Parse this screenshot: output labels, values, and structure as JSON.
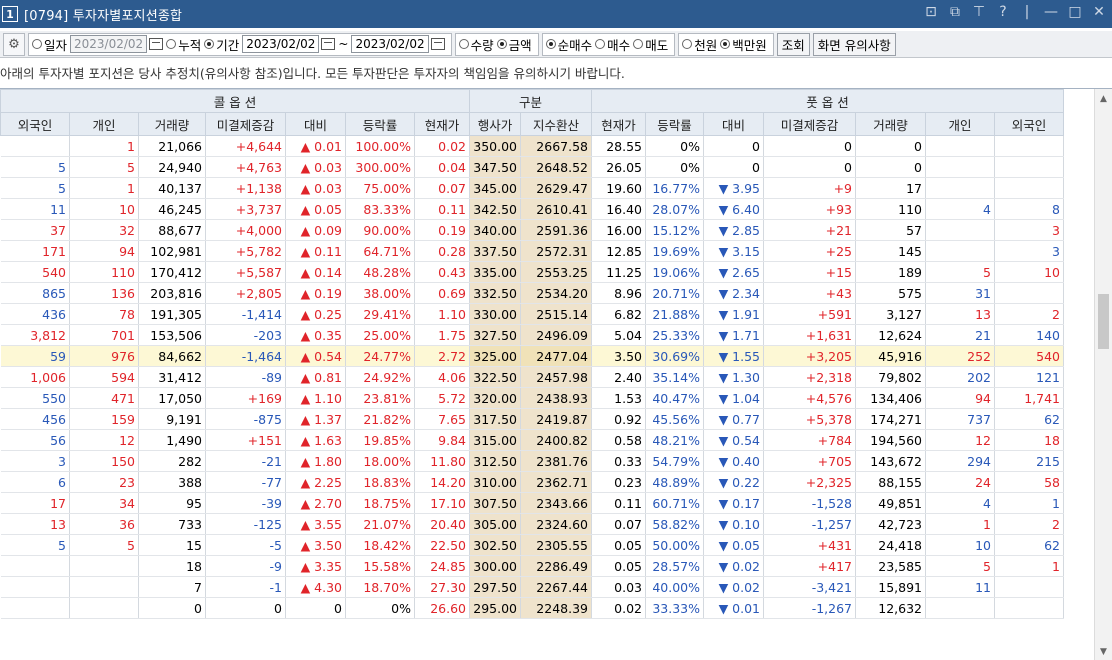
{
  "window": {
    "num": "1",
    "title": "[0794] 투자자별포지션종합",
    "controls": [
      "⊡",
      "⧉",
      "⊤",
      "?",
      "|",
      "—",
      "□",
      "✕"
    ]
  },
  "toolbar": {
    "gear_icon": "⚙",
    "radio_daily": "일자",
    "date_daily": "2023/02/02",
    "radio_cumulative": "누적",
    "radio_period": "기간",
    "date_from": "2023/02/02",
    "tilde": "~",
    "date_to": "2023/02/02",
    "radio_qty": "수량",
    "radio_amount": "금액",
    "radio_net_buy": "순매수",
    "radio_buy": "매수",
    "radio_sell": "매도",
    "radio_won": "천원",
    "radio_mil": "백만원",
    "btn_query": "조회",
    "btn_notice": "화면 유의사항"
  },
  "notice": "아래의 투자자별 포지션은 당사 추정치(유의사항 참조)입니다. 모든 투자판단은 투자자의 책임임을 유의하시기 바랍니다.",
  "grid": {
    "group_headers": {
      "call": "콜 옵 션",
      "mid": "구분",
      "put": "풋 옵 션"
    },
    "columns": [
      "외국인",
      "개인",
      "거래량",
      "미결제증감",
      "대비",
      "등락률",
      "현재가",
      "행사가",
      "지수환산",
      "현재가",
      "등락률",
      "대비",
      "미결제증감",
      "거래량",
      "개인",
      "외국인"
    ],
    "rows": [
      {
        "c_for": "",
        "c_ind": "1",
        "c_vol": "21,066",
        "c_oi": "+4,644",
        "c_chg": "▲ 0.01",
        "c_pct": "100.00%",
        "c_cur": "0.02",
        "strike": "350.00",
        "idx": "2667.58",
        "p_cur": "28.55",
        "p_pct": "0%",
        "p_chg": "0",
        "p_oi": "0",
        "p_vol": "0",
        "p_ind": "",
        "p_for": ""
      },
      {
        "c_for": "5",
        "c_ind": "5",
        "c_vol": "24,940",
        "c_oi": "+4,763",
        "c_chg": "▲ 0.03",
        "c_pct": "300.00%",
        "c_cur": "0.04",
        "strike": "347.50",
        "idx": "2648.52",
        "p_cur": "26.05",
        "p_pct": "0%",
        "p_chg": "0",
        "p_oi": "0",
        "p_vol": "0",
        "p_ind": "",
        "p_for": ""
      },
      {
        "c_for": "5",
        "c_ind": "1",
        "c_vol": "40,137",
        "c_oi": "+1,138",
        "c_chg": "▲ 0.03",
        "c_pct": "75.00%",
        "c_cur": "0.07",
        "strike": "345.00",
        "idx": "2629.47",
        "p_cur": "19.60",
        "p_pct": "16.77%",
        "p_chg": "▼ 3.95",
        "p_oi": "+9",
        "p_vol": "17",
        "p_ind": "",
        "p_for": ""
      },
      {
        "c_for": "11",
        "c_ind": "10",
        "c_vol": "46,245",
        "c_oi": "+3,737",
        "c_chg": "▲ 0.05",
        "c_pct": "83.33%",
        "c_cur": "0.11",
        "strike": "342.50",
        "idx": "2610.41",
        "p_cur": "16.40",
        "p_pct": "28.07%",
        "p_chg": "▼ 6.40",
        "p_oi": "+93",
        "p_vol": "110",
        "p_ind": "4",
        "p_for": "8"
      },
      {
        "c_for": "37",
        "c_ind": "32",
        "c_vol": "88,677",
        "c_oi": "+4,000",
        "c_chg": "▲ 0.09",
        "c_pct": "90.00%",
        "c_cur": "0.19",
        "strike": "340.00",
        "idx": "2591.36",
        "p_cur": "16.00",
        "p_pct": "15.12%",
        "p_chg": "▼ 2.85",
        "p_oi": "+21",
        "p_vol": "57",
        "p_ind": "",
        "p_for": "3"
      },
      {
        "c_for": "171",
        "c_ind": "94",
        "c_vol": "102,981",
        "c_oi": "+5,782",
        "c_chg": "▲ 0.11",
        "c_pct": "64.71%",
        "c_cur": "0.28",
        "strike": "337.50",
        "idx": "2572.31",
        "p_cur": "12.85",
        "p_pct": "19.69%",
        "p_chg": "▼ 3.15",
        "p_oi": "+25",
        "p_vol": "145",
        "p_ind": "",
        "p_for": "3"
      },
      {
        "c_for": "540",
        "c_ind": "110",
        "c_vol": "170,412",
        "c_oi": "+5,587",
        "c_chg": "▲ 0.14",
        "c_pct": "48.28%",
        "c_cur": "0.43",
        "strike": "335.00",
        "idx": "2553.25",
        "p_cur": "11.25",
        "p_pct": "19.06%",
        "p_chg": "▼ 2.65",
        "p_oi": "+15",
        "p_vol": "189",
        "p_ind": "5",
        "p_for": "10"
      },
      {
        "c_for": "865",
        "c_ind": "136",
        "c_vol": "203,816",
        "c_oi": "+2,805",
        "c_chg": "▲ 0.19",
        "c_pct": "38.00%",
        "c_cur": "0.69",
        "strike": "332.50",
        "idx": "2534.20",
        "p_cur": "8.96",
        "p_pct": "20.71%",
        "p_chg": "▼ 2.34",
        "p_oi": "+43",
        "p_vol": "575",
        "p_ind": "31",
        "p_for": ""
      },
      {
        "c_for": "436",
        "c_ind": "78",
        "c_vol": "191,305",
        "c_oi": "-1,414",
        "c_chg": "▲ 0.25",
        "c_pct": "29.41%",
        "c_cur": "1.10",
        "strike": "330.00",
        "idx": "2515.14",
        "p_cur": "6.82",
        "p_pct": "21.88%",
        "p_chg": "▼ 1.91",
        "p_oi": "+591",
        "p_vol": "3,127",
        "p_ind": "13",
        "p_for": "2"
      },
      {
        "c_for": "3,812",
        "c_ind": "701",
        "c_vol": "153,506",
        "c_oi": "-203",
        "c_chg": "▲ 0.35",
        "c_pct": "25.00%",
        "c_cur": "1.75",
        "strike": "327.50",
        "idx": "2496.09",
        "p_cur": "5.04",
        "p_pct": "25.33%",
        "p_chg": "▼ 1.71",
        "p_oi": "+1,631",
        "p_vol": "12,624",
        "p_ind": "21",
        "p_for": "140"
      },
      {
        "c_for": "59",
        "c_ind": "976",
        "c_vol": "84,662",
        "c_oi": "-1,464",
        "c_chg": "▲ 0.54",
        "c_pct": "24.77%",
        "c_cur": "2.72",
        "strike": "325.00",
        "idx": "2477.04",
        "p_cur": "3.50",
        "p_pct": "30.69%",
        "p_chg": "▼ 1.55",
        "p_oi": "+3,205",
        "p_vol": "45,916",
        "p_ind": "252",
        "p_for": "540",
        "hl": true
      },
      {
        "c_for": "1,006",
        "c_ind": "594",
        "c_vol": "31,412",
        "c_oi": "-89",
        "c_chg": "▲ 0.81",
        "c_pct": "24.92%",
        "c_cur": "4.06",
        "strike": "322.50",
        "idx": "2457.98",
        "p_cur": "2.40",
        "p_pct": "35.14%",
        "p_chg": "▼ 1.30",
        "p_oi": "+2,318",
        "p_vol": "79,802",
        "p_ind": "202",
        "p_for": "121"
      },
      {
        "c_for": "550",
        "c_ind": "471",
        "c_vol": "17,050",
        "c_oi": "+169",
        "c_chg": "▲ 1.10",
        "c_pct": "23.81%",
        "c_cur": "5.72",
        "strike": "320.00",
        "idx": "2438.93",
        "p_cur": "1.53",
        "p_pct": "40.47%",
        "p_chg": "▼ 1.04",
        "p_oi": "+4,576",
        "p_vol": "134,406",
        "p_ind": "94",
        "p_for": "1,741"
      },
      {
        "c_for": "456",
        "c_ind": "159",
        "c_vol": "9,191",
        "c_oi": "-875",
        "c_chg": "▲ 1.37",
        "c_pct": "21.82%",
        "c_cur": "7.65",
        "strike": "317.50",
        "idx": "2419.87",
        "p_cur": "0.92",
        "p_pct": "45.56%",
        "p_chg": "▼ 0.77",
        "p_oi": "+5,378",
        "p_vol": "174,271",
        "p_ind": "737",
        "p_for": "62"
      },
      {
        "c_for": "56",
        "c_ind": "12",
        "c_vol": "1,490",
        "c_oi": "+151",
        "c_chg": "▲ 1.63",
        "c_pct": "19.85%",
        "c_cur": "9.84",
        "strike": "315.00",
        "idx": "2400.82",
        "p_cur": "0.58",
        "p_pct": "48.21%",
        "p_chg": "▼ 0.54",
        "p_oi": "+784",
        "p_vol": "194,560",
        "p_ind": "12",
        "p_for": "18"
      },
      {
        "c_for": "3",
        "c_ind": "150",
        "c_vol": "282",
        "c_oi": "-21",
        "c_chg": "▲ 1.80",
        "c_pct": "18.00%",
        "c_cur": "11.80",
        "strike": "312.50",
        "idx": "2381.76",
        "p_cur": "0.33",
        "p_pct": "54.79%",
        "p_chg": "▼ 0.40",
        "p_oi": "+705",
        "p_vol": "143,672",
        "p_ind": "294",
        "p_for": "215"
      },
      {
        "c_for": "6",
        "c_ind": "23",
        "c_vol": "388",
        "c_oi": "-77",
        "c_chg": "▲ 2.25",
        "c_pct": "18.83%",
        "c_cur": "14.20",
        "strike": "310.00",
        "idx": "2362.71",
        "p_cur": "0.23",
        "p_pct": "48.89%",
        "p_chg": "▼ 0.22",
        "p_oi": "+2,325",
        "p_vol": "88,155",
        "p_ind": "24",
        "p_for": "58"
      },
      {
        "c_for": "17",
        "c_ind": "34",
        "c_vol": "95",
        "c_oi": "-39",
        "c_chg": "▲ 2.70",
        "c_pct": "18.75%",
        "c_cur": "17.10",
        "strike": "307.50",
        "idx": "2343.66",
        "p_cur": "0.11",
        "p_pct": "60.71%",
        "p_chg": "▼ 0.17",
        "p_oi": "-1,528",
        "p_vol": "49,851",
        "p_ind": "4",
        "p_for": "1"
      },
      {
        "c_for": "13",
        "c_ind": "36",
        "c_vol": "733",
        "c_oi": "-125",
        "c_chg": "▲ 3.55",
        "c_pct": "21.07%",
        "c_cur": "20.40",
        "strike": "305.00",
        "idx": "2324.60",
        "p_cur": "0.07",
        "p_pct": "58.82%",
        "p_chg": "▼ 0.10",
        "p_oi": "-1,257",
        "p_vol": "42,723",
        "p_ind": "1",
        "p_for": "2"
      },
      {
        "c_for": "5",
        "c_ind": "5",
        "c_vol": "15",
        "c_oi": "-5",
        "c_chg": "▲ 3.50",
        "c_pct": "18.42%",
        "c_cur": "22.50",
        "strike": "302.50",
        "idx": "2305.55",
        "p_cur": "0.05",
        "p_pct": "50.00%",
        "p_chg": "▼ 0.05",
        "p_oi": "+431",
        "p_vol": "24,418",
        "p_ind": "10",
        "p_for": "62"
      },
      {
        "c_for": "",
        "c_ind": "",
        "c_vol": "18",
        "c_oi": "-9",
        "c_chg": "▲ 3.35",
        "c_pct": "15.58%",
        "c_cur": "24.85",
        "strike": "300.00",
        "idx": "2286.49",
        "p_cur": "0.05",
        "p_pct": "28.57%",
        "p_chg": "▼ 0.02",
        "p_oi": "+417",
        "p_vol": "23,585",
        "p_ind": "5",
        "p_for": "1"
      },
      {
        "c_for": "",
        "c_ind": "",
        "c_vol": "7",
        "c_oi": "-1",
        "c_chg": "▲ 4.30",
        "c_pct": "18.70%",
        "c_cur": "27.30",
        "strike": "297.50",
        "idx": "2267.44",
        "p_cur": "0.03",
        "p_pct": "40.00%",
        "p_chg": "▼ 0.02",
        "p_oi": "-3,421",
        "p_vol": "15,891",
        "p_ind": "11",
        "p_for": ""
      },
      {
        "c_for": "",
        "c_ind": "",
        "c_vol": "0",
        "c_oi": "0",
        "c_chg": "0",
        "c_pct": "0%",
        "c_cur": "26.60",
        "strike": "295.00",
        "idx": "2248.39",
        "p_cur": "0.02",
        "p_pct": "33.33%",
        "p_chg": "▼ 0.01",
        "p_oi": "-1,267",
        "p_vol": "12,632",
        "p_ind": "",
        "p_for": ""
      }
    ]
  },
  "colors": {
    "title_bg": "#2d5b8f",
    "up": "#e0242a",
    "down": "#2958b8",
    "mid_bg": "#efe3cc",
    "highlight_row": "#fdf8d5",
    "header_bg": "#e6ecf3"
  },
  "scrollbar": {
    "up_arrow": "▲",
    "down_arrow": "▼"
  }
}
